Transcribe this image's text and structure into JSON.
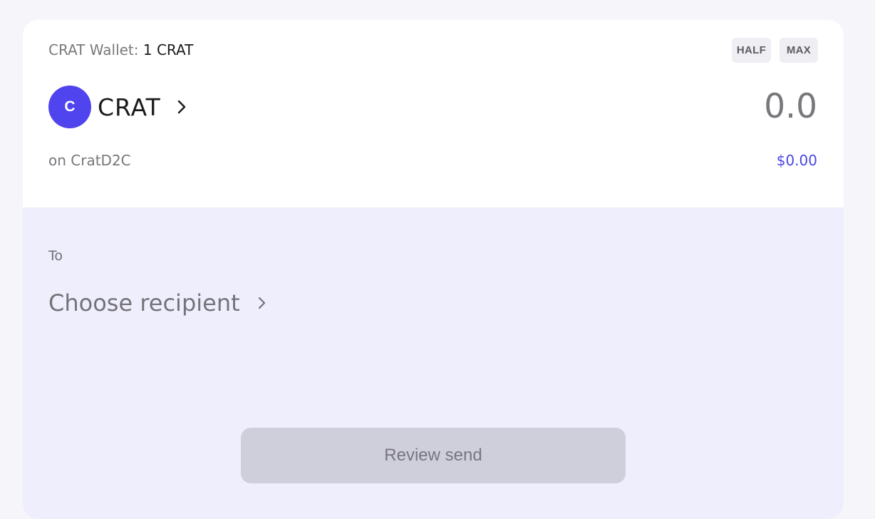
{
  "wallet": {
    "label": "CRAT Wallet:",
    "balance": "1 CRAT"
  },
  "quick_amounts": {
    "half_label": "HALF",
    "max_label": "MAX"
  },
  "token": {
    "avatar_letter": "C",
    "symbol": "CRAT",
    "network": "on CratD2C",
    "accent_color": "#4f44ee"
  },
  "amount": {
    "value": "0.0",
    "usd_value": "$0.00"
  },
  "recipient": {
    "label": "To",
    "placeholder": "Choose recipient"
  },
  "actions": {
    "review_label": "Review send"
  },
  "icons": {
    "token_chevron": "chevron-right-icon",
    "recipient_chevron": "chevron-right-icon"
  }
}
